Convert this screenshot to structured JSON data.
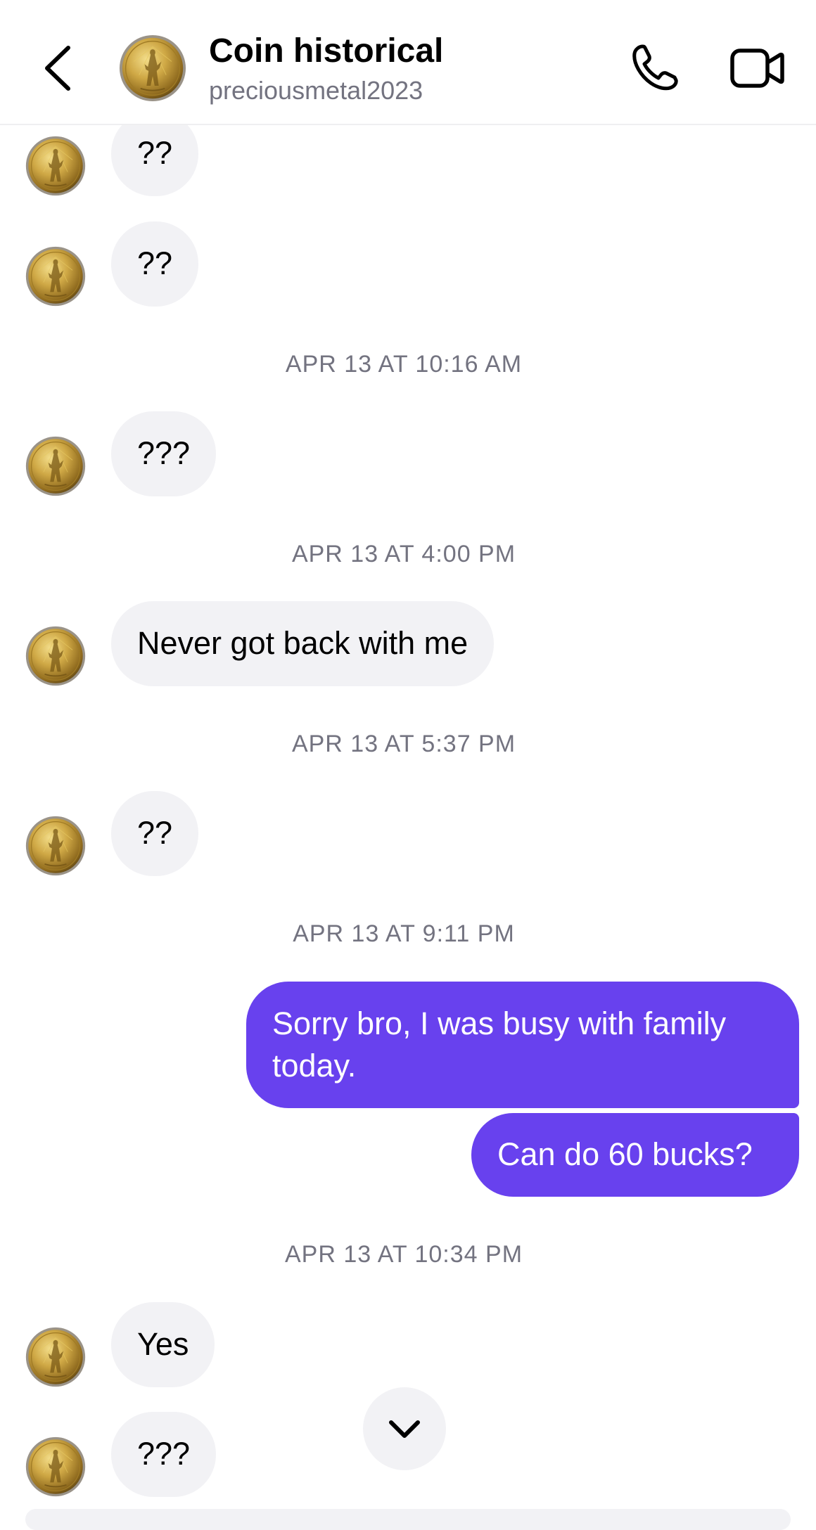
{
  "header": {
    "title": "Coin historical",
    "username": "preciousmetal2023",
    "icons": [
      "back-chevron-icon",
      "coin-avatar",
      "phone-icon",
      "video-camera-icon"
    ]
  },
  "messages": [
    {
      "from": "them",
      "text": "??"
    },
    {
      "from": "them",
      "text": "??"
    },
    {
      "timestamp": "APR 13 AT 10:16 AM"
    },
    {
      "from": "them",
      "text": "???"
    },
    {
      "timestamp": "APR 13 AT 4:00 PM"
    },
    {
      "from": "them",
      "text": "Never got back with me"
    },
    {
      "timestamp": "APR 13 AT 5:37 PM"
    },
    {
      "from": "them",
      "text": "??"
    },
    {
      "timestamp": "APR 13 AT 9:11 PM"
    },
    {
      "from": "me",
      "lines": [
        "Sorry bro, I was busy with family",
        "today."
      ]
    },
    {
      "from": "me",
      "text": "Can do 60 bucks?"
    },
    {
      "timestamp": "APR 13 AT 10:34 PM"
    },
    {
      "from": "them",
      "text": "Yes"
    },
    {
      "from": "them",
      "text": "???"
    }
  ],
  "colors": {
    "outgoing_bubble": "#6841ee",
    "incoming_bubble": "#f2f2f5",
    "secondary_text": "#737380",
    "coin_gold": "#c9a23a"
  }
}
